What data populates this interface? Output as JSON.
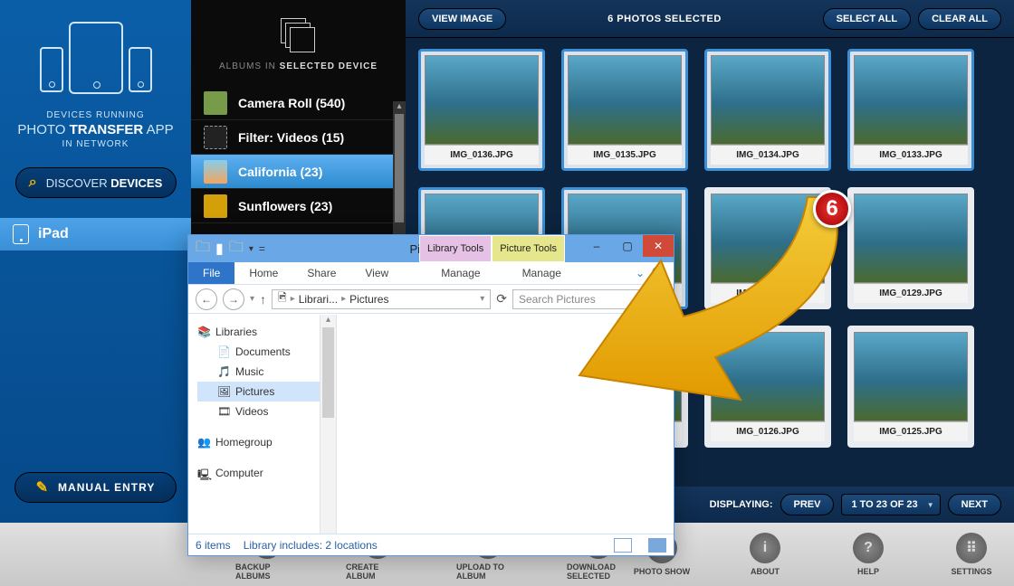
{
  "left": {
    "subtitle1": "DEVICES RUNNING",
    "app_name": "PHOTO TRANSFER APP",
    "subtitle2": "IN NETWORK",
    "discover_prefix": "DISCOVER",
    "discover_suffix": " DEVICES",
    "device": "iPad",
    "manual": "MANUAL ENTRY"
  },
  "albums": {
    "title_prefix": "ALBUMS IN ",
    "title_strong": "SELECTED DEVICE",
    "items": [
      {
        "label": "Camera Roll (540)"
      },
      {
        "label": "Filter: Videos (15)"
      },
      {
        "label": "California (23)"
      },
      {
        "label": "Sunflowers (23)"
      }
    ]
  },
  "top": {
    "view_image": "VIEW IMAGE",
    "selected": "6 PHOTOS SELECTED",
    "select_all": "SELECT ALL",
    "clear_all": "CLEAR ALL"
  },
  "photos": [
    {
      "cap": "IMG_0136.JPG",
      "sel": true
    },
    {
      "cap": "IMG_0135.JPG",
      "sel": true
    },
    {
      "cap": "IMG_0134.JPG",
      "sel": true
    },
    {
      "cap": "IMG_0133.JPG",
      "sel": true
    },
    {
      "cap": "",
      "sel": true
    },
    {
      "cap": "",
      "sel": true
    },
    {
      "cap": "IMG_0130.JPG",
      "sel": false
    },
    {
      "cap": "IMG_0129.JPG",
      "sel": false
    },
    {
      "cap": "",
      "sel": false
    },
    {
      "cap": "",
      "sel": false
    },
    {
      "cap": "IMG_0126.JPG",
      "sel": false
    },
    {
      "cap": "IMG_0125.JPG",
      "sel": false
    }
  ],
  "pager": {
    "displaying": "DISPLAYING:",
    "prev": "PREV",
    "range": "1 TO 23 OF 23",
    "next": "NEXT"
  },
  "bottom": {
    "backup": "BACKUP ALBUMS",
    "create": "CREATE ALBUM",
    "upload": "UPLOAD TO ALBUM",
    "download": "DOWNLOAD SELECTED",
    "photoshow": "PHOTO SHOW",
    "about": "ABOUT",
    "help": "HELP",
    "settings": "SETTINGS"
  },
  "badge": "6",
  "explorer": {
    "title": "Pictures",
    "tab_lib": "Library Tools",
    "tab_pic": "Picture Tools",
    "file": "File",
    "home": "Home",
    "share": "Share",
    "view": "View",
    "manage1": "Manage",
    "manage2": "Manage",
    "path_root": "Librari...",
    "path_leaf": "Pictures",
    "search_ph": "Search Pictures",
    "tree": {
      "libraries": "Libraries",
      "documents": "Documents",
      "music": "Music",
      "pictures": "Pictures",
      "videos": "Videos",
      "homegroup": "Homegroup",
      "computer": "Computer"
    },
    "status_items": "6 items",
    "status_lib": "Library includes: 2 locations"
  }
}
